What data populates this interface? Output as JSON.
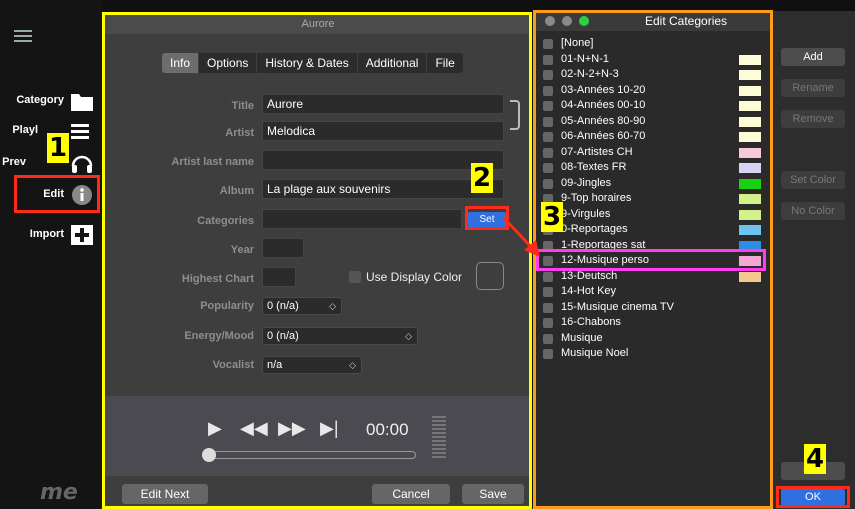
{
  "sidebar": {
    "items": [
      {
        "label": "Category",
        "icon": "folder-icon"
      },
      {
        "label": "Playl",
        "icon": "playlist-icon"
      },
      {
        "label": "Prev",
        "icon": "headphones-icon"
      },
      {
        "label": "Edit",
        "icon": "info-icon"
      },
      {
        "label": "Import",
        "icon": "plus-icon"
      }
    ],
    "brand": "me"
  },
  "editor": {
    "title": "Aurore",
    "tabs": [
      "Info",
      "Options",
      "History & Dates",
      "Additional",
      "File"
    ],
    "fields": {
      "title_label": "Title",
      "title_value": "Aurore",
      "artist_label": "Artist",
      "artist_value": "Melodica",
      "artist_last_label": "Artist last name",
      "artist_last_value": "",
      "album_label": "Album",
      "album_value": "La plage aux souvenirs",
      "categories_label": "Categories",
      "categories_value": "",
      "set_label": "Set",
      "year_label": "Year",
      "year_value": "",
      "highest_chart_label": "Highest Chart",
      "highest_chart_value": "",
      "use_display_color_label": "Use Display Color",
      "popularity_label": "Popularity",
      "popularity_value": "0 (n/a)",
      "energy_label": "Energy/Mood",
      "energy_value": "0 (n/a)",
      "vocalist_label": "Vocalist",
      "vocalist_value": "n/a"
    },
    "player": {
      "time": "00:00",
      "progress": 0
    },
    "buttons": {
      "edit_next": "Edit Next",
      "cancel": "Cancel",
      "save": "Save"
    }
  },
  "categories": {
    "title": "Edit Categories",
    "items": [
      {
        "name": "[None]",
        "color": ""
      },
      {
        "name": "01-N+N-1",
        "color": "#fdfcd9"
      },
      {
        "name": "02-N-2+N-3",
        "color": "#fdfcd9"
      },
      {
        "name": "03-Années 10-20",
        "color": "#fdfcd9"
      },
      {
        "name": "04-Années 00-10",
        "color": "#fdfcd9"
      },
      {
        "name": "05-Années 80-90",
        "color": "#fdfcd9"
      },
      {
        "name": "06-Années 60-70",
        "color": "#fdfcd9"
      },
      {
        "name": "07-Artistes CH",
        "color": "#f7c9d8"
      },
      {
        "name": "08-Textes FR",
        "color": "#d9d3f3"
      },
      {
        "name": "09-Jingles",
        "color": "#17d00f"
      },
      {
        "name": "9-Top horaires",
        "color": "#d4f08a"
      },
      {
        "name": "9-Virgules",
        "color": "#d4f08a"
      },
      {
        "name": "0-Reportages",
        "color": "#6ec4ef"
      },
      {
        "name": "1-Reportages sat",
        "color": "#2f8de8"
      },
      {
        "name": "12-Musique perso",
        "color": "#f4a6d6"
      },
      {
        "name": "13-Deutsch",
        "color": "#f3c98f"
      },
      {
        "name": "14-Hot Key",
        "color": ""
      },
      {
        "name": "15-Musique cinema TV",
        "color": ""
      },
      {
        "name": "16-Chabons",
        "color": ""
      },
      {
        "name": "Musique",
        "color": ""
      },
      {
        "name": "Musique Noel",
        "color": ""
      }
    ],
    "buttons": {
      "add": "Add",
      "rename": "Rename",
      "remove": "Remove",
      "set_color": "Set Color",
      "no_color": "No Color",
      "cancel": "C el",
      "ok": "OK"
    }
  },
  "annotations": {
    "step1": "1",
    "step2": "2",
    "step3": "3",
    "step4": "4",
    "colors": {
      "yellow": "#ffff00",
      "orange": "#ff9a1a",
      "red": "#ff2a1a",
      "magenta": "#ff3cf0"
    }
  }
}
